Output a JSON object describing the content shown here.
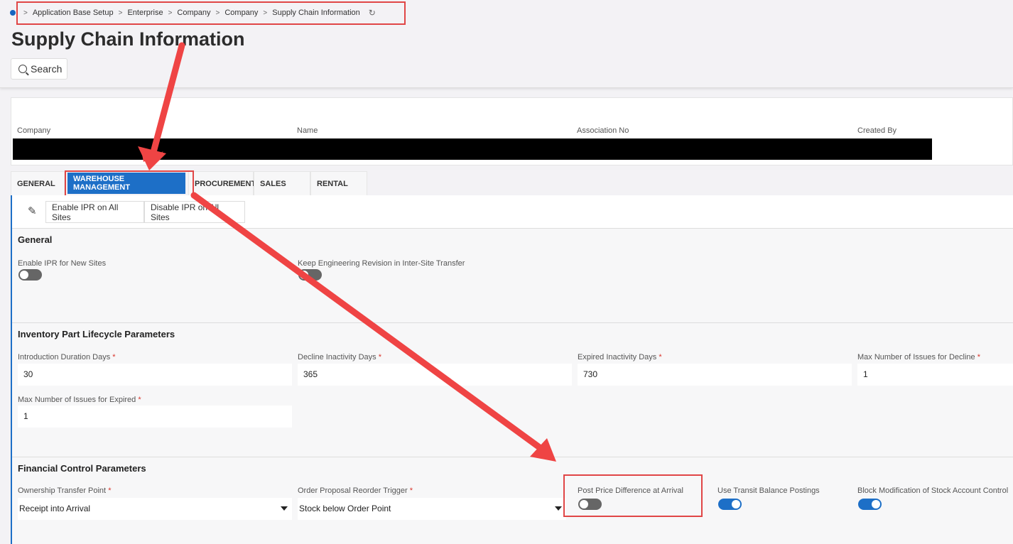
{
  "breadcrumb": [
    "Application Base Setup",
    "Enterprise",
    "Company",
    "Company",
    "Supply Chain Information"
  ],
  "page_title": "Supply Chain Information",
  "search_label": "Search",
  "header": {
    "company_label": "Company",
    "name_label": "Name",
    "association_label": "Association No",
    "created_by_label": "Created By"
  },
  "tabs": [
    {
      "label": "GENERAL",
      "active": false
    },
    {
      "label": "WAREHOUSE MANAGEMENT",
      "active": true
    },
    {
      "label": "PROCUREMENT",
      "active": false
    },
    {
      "label": "SALES",
      "active": false
    },
    {
      "label": "RENTAL",
      "active": false
    }
  ],
  "toolbar": {
    "enable_label": "Enable IPR on All Sites",
    "disable_label": "Disable IPR on All Sites"
  },
  "general": {
    "title": "General",
    "enable_ipr_label": "Enable IPR for New Sites",
    "enable_ipr_on": false,
    "keep_rev_label": "Keep Engineering Revision in Inter-Site Transfer",
    "keep_rev_on": false
  },
  "lifecycle": {
    "title": "Inventory Part Lifecycle Parameters",
    "intro_label": "Introduction Duration Days",
    "intro_value": "30",
    "decline_label": "Decline Inactivity Days",
    "decline_value": "365",
    "expired_label": "Expired Inactivity Days",
    "expired_value": "730",
    "max_decline_label": "Max Number of Issues for Decline",
    "max_decline_value": "1",
    "max_expired_label": "Max Number of Issues for Expired",
    "max_expired_value": "1",
    "required_mark": "*"
  },
  "financial": {
    "title": "Financial Control Parameters",
    "ownership_label": "Ownership Transfer Point",
    "ownership_value": "Receipt into Arrival",
    "reorder_label": "Order Proposal Reorder Trigger",
    "reorder_value": "Stock below Order Point",
    "post_price_label": "Post Price Difference at Arrival",
    "post_price_on": false,
    "transit_label": "Use Transit Balance Postings",
    "transit_on": true,
    "block_label": "Block Modification of Stock Account Control",
    "block_on": true
  },
  "colors": {
    "accent": "#1d6fc7",
    "annotation": "#e04646"
  }
}
